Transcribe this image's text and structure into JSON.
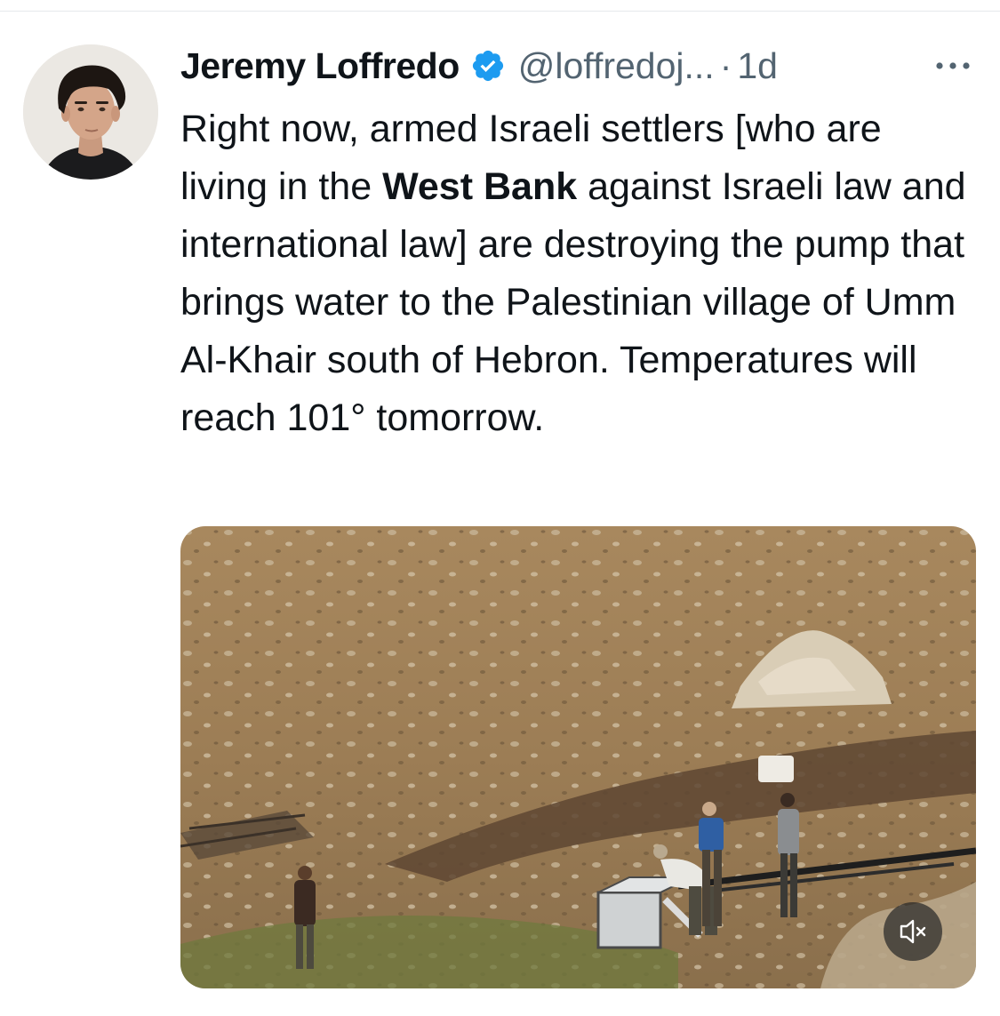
{
  "tweet": {
    "author": {
      "display_name": "Jeremy Loffredo",
      "handle": "@loffredoj...",
      "verified": true,
      "avatar_icon": "profile-photo"
    },
    "separator": "·",
    "timestamp": "1d",
    "more_icon": "more-horizontal-icon",
    "text": {
      "part1": "Right now, armed Israeli settlers [who are living in the ",
      "bold": "West Bank",
      "part2": " against Israeli law and international law] are destroying the pump that brings water to the Palestinian village of Umm Al-Khair south of Hebron. Temperatures will reach 101° tomorrow."
    },
    "media": {
      "type": "video",
      "mute_icon": "speaker-muted-icon"
    }
  },
  "colors": {
    "text_primary": "#0f1419",
    "text_secondary": "#536471",
    "verified_blue": "#1d9bf0",
    "divider": "#e6e9ec"
  }
}
